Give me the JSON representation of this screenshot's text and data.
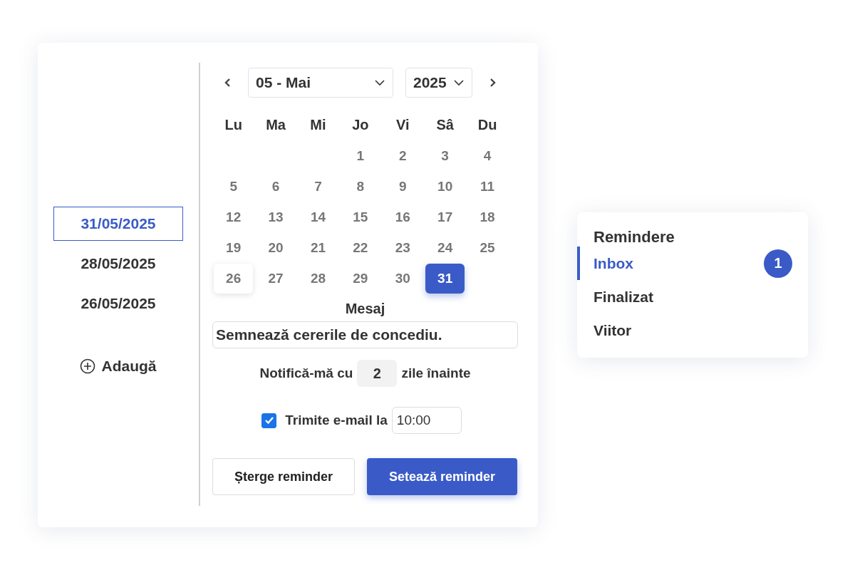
{
  "dates": [
    {
      "label": "31/05/2025",
      "selected": true
    },
    {
      "label": "28/05/2025",
      "selected": false
    },
    {
      "label": "26/05/2025",
      "selected": false
    }
  ],
  "add_button": {
    "label": "Adaugă"
  },
  "calendar": {
    "month": "05 - Mai",
    "year": "2025",
    "weekdays": [
      "Lu",
      "Ma",
      "Mi",
      "Jo",
      "Vi",
      "Sâ",
      "Du"
    ],
    "weeks": [
      {
        "days": [
          {
            "label": "1",
            "selected": false,
            "marked": false
          },
          {
            "label": "2",
            "selected": false,
            "marked": false
          },
          {
            "label": "3",
            "selected": false,
            "marked": false
          },
          {
            "label": "4",
            "selected": false,
            "marked": false
          }
        ]
      },
      {
        "days": [
          {
            "label": "5",
            "selected": false,
            "marked": false
          },
          {
            "label": "6",
            "selected": false,
            "marked": false
          },
          {
            "label": "7",
            "selected": false,
            "marked": false
          },
          {
            "label": "8",
            "selected": false,
            "marked": false
          },
          {
            "label": "9",
            "selected": false,
            "marked": false
          },
          {
            "label": "10",
            "selected": false,
            "marked": false
          },
          {
            "label": "11",
            "selected": false,
            "marked": false
          }
        ]
      },
      {
        "days": [
          {
            "label": "12",
            "selected": false,
            "marked": false
          },
          {
            "label": "13",
            "selected": false,
            "marked": false
          },
          {
            "label": "14",
            "selected": false,
            "marked": false
          },
          {
            "label": "15",
            "selected": false,
            "marked": false
          },
          {
            "label": "16",
            "selected": false,
            "marked": false
          },
          {
            "label": "17",
            "selected": false,
            "marked": false
          },
          {
            "label": "18",
            "selected": false,
            "marked": false
          }
        ]
      },
      {
        "days": [
          {
            "label": "19",
            "selected": false,
            "marked": false
          },
          {
            "label": "20",
            "selected": false,
            "marked": false
          },
          {
            "label": "21",
            "selected": false,
            "marked": false
          },
          {
            "label": "22",
            "selected": false,
            "marked": false
          },
          {
            "label": "23",
            "selected": false,
            "marked": false
          },
          {
            "label": "24",
            "selected": false,
            "marked": false
          },
          {
            "label": "25",
            "selected": false,
            "marked": false
          }
        ]
      },
      {
        "days": [
          {
            "label": "26",
            "selected": false,
            "marked": true
          },
          {
            "label": "27",
            "selected": false,
            "marked": false
          },
          {
            "label": "28",
            "selected": false,
            "marked": false
          },
          {
            "label": "29",
            "selected": false,
            "marked": false
          },
          {
            "label": "30",
            "selected": false,
            "marked": false
          },
          {
            "label": "31",
            "selected": true,
            "marked": false
          }
        ]
      }
    ]
  },
  "message": {
    "label": "Mesaj",
    "value": "Semnează cererile de concediu."
  },
  "notify": {
    "before": "Notifică-mă cu",
    "value": "2",
    "after": "zile înainte"
  },
  "email": {
    "checked": true,
    "label": "Trimite e-mail la",
    "time": "10:00"
  },
  "buttons": [
    {
      "label": "Șterge reminder",
      "kind": "secondary"
    },
    {
      "label": "Setează reminder",
      "kind": "primary"
    }
  ],
  "sidebar": {
    "title": "Remindere",
    "items": [
      {
        "label": "Inbox",
        "selected": true,
        "badge": "1"
      },
      {
        "label": "Finalizat",
        "selected": false
      },
      {
        "label": "Viitor",
        "selected": false
      }
    ]
  }
}
